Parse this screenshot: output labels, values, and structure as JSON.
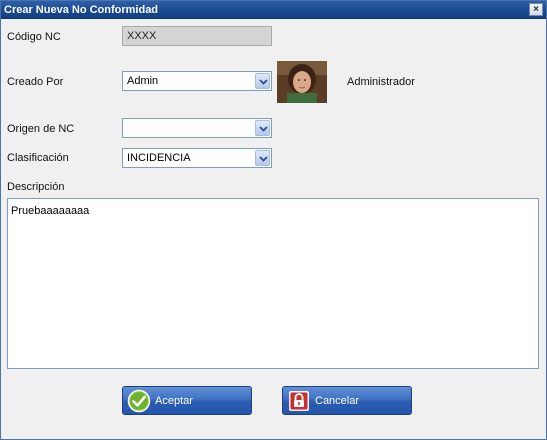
{
  "window": {
    "title": "Crear Nueva No Conformidad",
    "close_symbol": "×"
  },
  "fields": {
    "codigo": {
      "label": "Código NC",
      "value": "XXXX"
    },
    "creado_por": {
      "label": "Creado Por",
      "value": "Admin",
      "user_name": "Administrador"
    },
    "origen": {
      "label": "Origen de NC",
      "value": ""
    },
    "clasificacion": {
      "label": "Clasificación",
      "value": "INCIDENCIA"
    },
    "descripcion": {
      "label": "Descripción",
      "value": "Pruebaaaaaaaa"
    }
  },
  "buttons": {
    "accept_label": "Aceptar",
    "cancel_label": "Cancelar"
  },
  "icons": {
    "accept": "check-icon",
    "cancel": "lock-icon",
    "dropdown": "chevron-down-icon"
  }
}
